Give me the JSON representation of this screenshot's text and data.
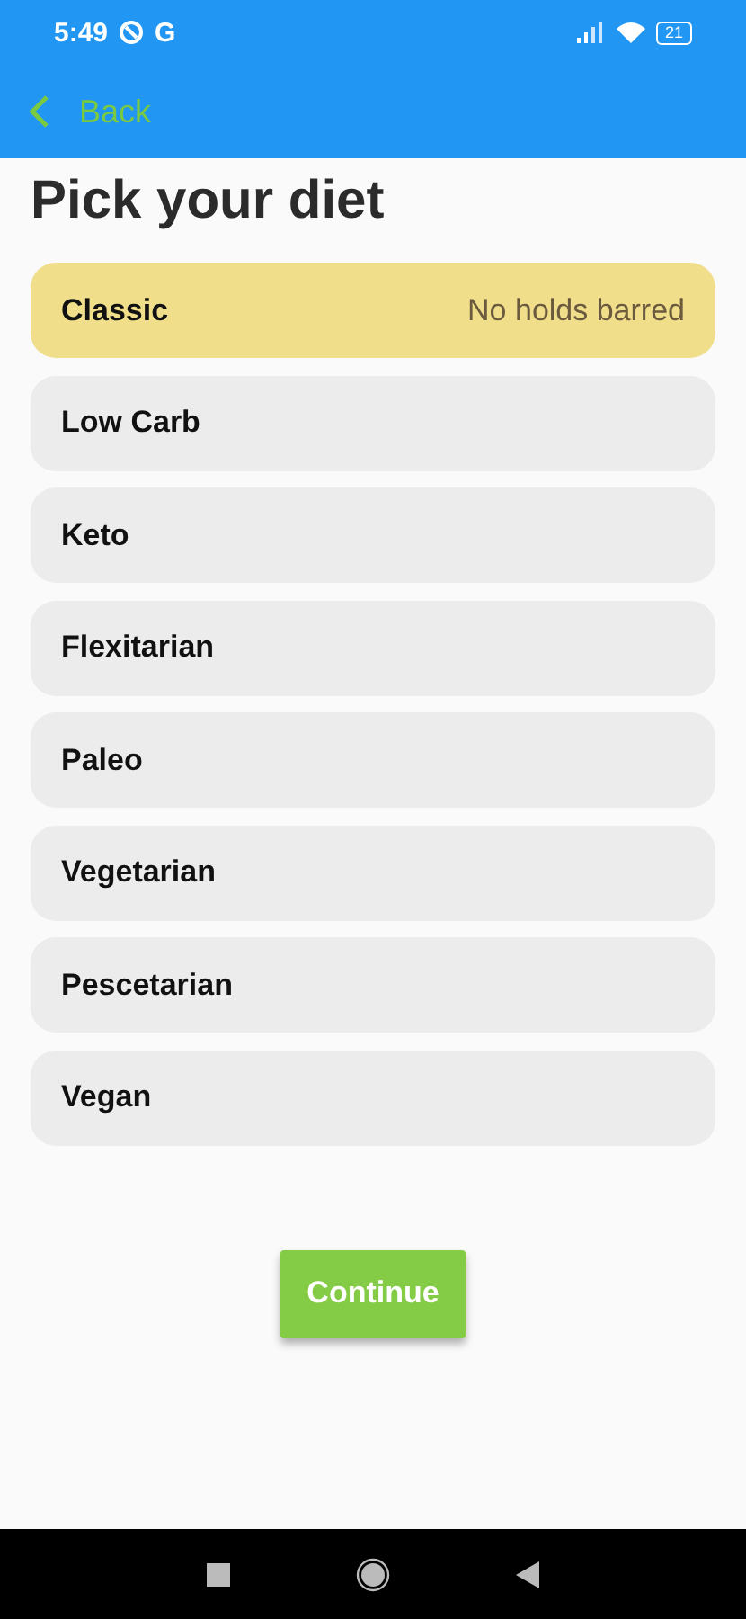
{
  "status_bar": {
    "time": "5:49",
    "carrier_glyph": "G",
    "battery": "21"
  },
  "app_bar": {
    "back_label": "Back"
  },
  "title": "Pick your diet",
  "diets": [
    {
      "name": "Classic",
      "description": "No holds barred",
      "selected": true
    },
    {
      "name": "Low Carb",
      "selected": false
    },
    {
      "name": "Keto",
      "selected": false
    },
    {
      "name": "Flexitarian",
      "selected": false
    },
    {
      "name": "Paleo",
      "selected": false
    },
    {
      "name": "Vegetarian",
      "selected": false
    },
    {
      "name": "Pescetarian",
      "selected": false
    },
    {
      "name": "Vegan",
      "selected": false
    }
  ],
  "continue_button": "Continue"
}
